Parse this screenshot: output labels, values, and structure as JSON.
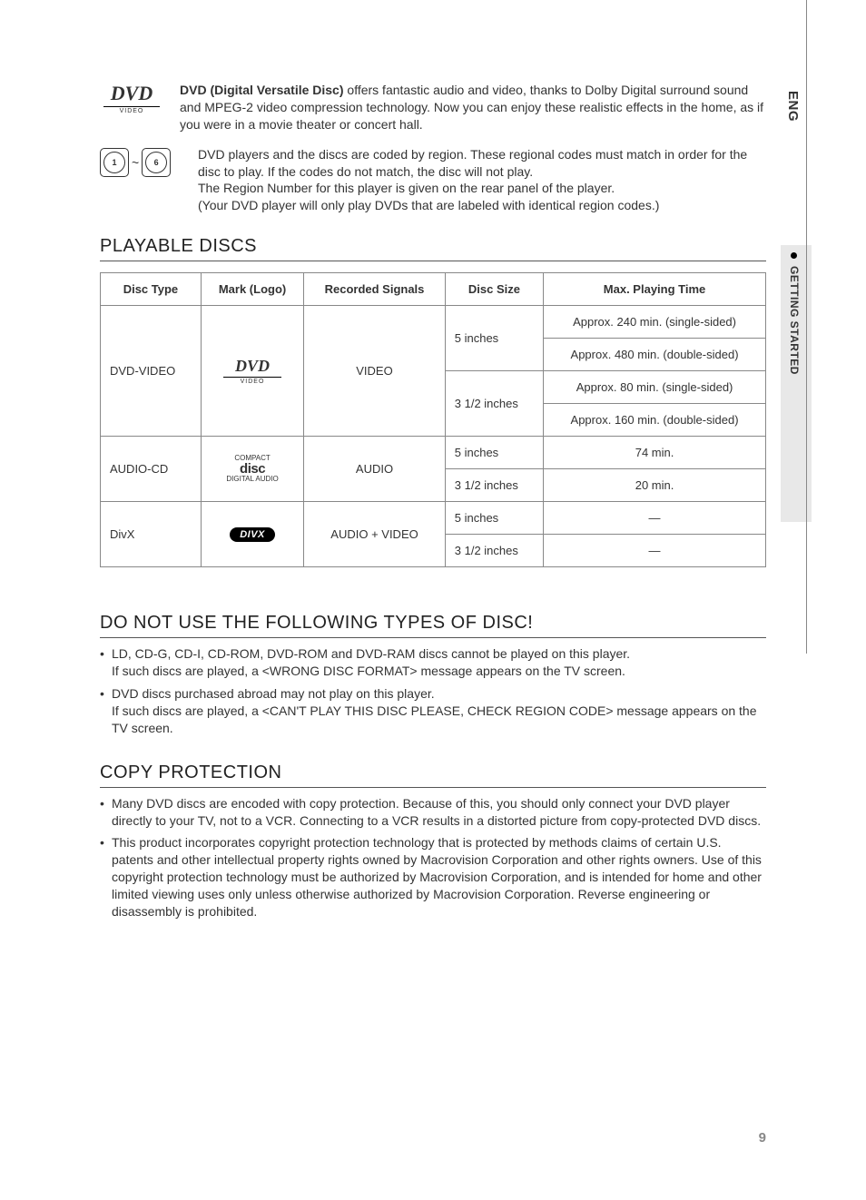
{
  "side": {
    "lang": "ENG",
    "section": "GETTING STARTED"
  },
  "intro": {
    "bold": "DVD (Digital Versatile Disc)",
    "p1_rest": " offers fantastic audio and video, thanks to Dolby Digital surround sound and MPEG-2 video compression technology. Now you can enjoy these realistic effects in the home, as if you were in a movie theater or concert hall.",
    "region_num1": "1",
    "region_tilde": "~",
    "region_num2": "6",
    "p2": "DVD players and the discs are coded by region. These regional codes must match in order for the disc to play. If the codes do not match, the disc will not play.",
    "p2b": "The Region Number for this player is given on the rear panel of the player.",
    "p2c": "(Your DVD player will only play DVDs that are labeled with identical region codes.)",
    "dvd_logo_main": "DVD",
    "dvd_logo_sub": "VIDEO"
  },
  "playable": {
    "heading": "PLAYABLE DISCS",
    "th1": "Disc Type",
    "th2": "Mark (Logo)",
    "th3": "Recorded Signals",
    "th4": "Disc Size",
    "th5": "Max. Playing Time",
    "r1_type": "DVD-VIDEO",
    "r1_signals": "VIDEO",
    "r1_size1": "5 inches",
    "r1_time1": "Approx. 240 min. (single-sided)",
    "r1_time2": "Approx. 480 min. (double-sided)",
    "r1_size2": "3 1/2 inches",
    "r1_time3": "Approx. 80 min. (single-sided)",
    "r1_time4": "Approx. 160 min. (double-sided)",
    "r2_type": "AUDIO-CD",
    "r2_signals": "AUDIO",
    "r2_size1": "5 inches",
    "r2_time1": "74 min.",
    "r2_size2": "3 1/2 inches",
    "r2_time2": "20 min.",
    "r3_type": "DivX",
    "r3_signals": "AUDIO + VIDEO",
    "r3_size1": "5 inches",
    "r3_time1": "—",
    "r3_size2": "3 1/2 inches",
    "r3_time2": "—",
    "divx_mark": "DIVX",
    "cd_logo_top": "COMPACT",
    "cd_logo_mid": "disc",
    "cd_logo_bot": "DIGITAL AUDIO"
  },
  "donotuse": {
    "heading": "DO NOT USE THE FOLLOWING TYPES OF DISC!",
    "b1a": "LD, CD-G, CD-I, CD-ROM, DVD-ROM and DVD-RAM discs cannot be played on this player.",
    "b1b": "If such discs are played, a <WRONG DISC FORMAT> message appears on the TV screen.",
    "b2a": "DVD discs purchased abroad may not play on this player.",
    "b2b": "If such discs are played, a <CAN'T PLAY THIS DISC PLEASE, CHECK REGION CODE> message appears on the TV screen."
  },
  "copy": {
    "heading": "COPY PROTECTION",
    "b1": "Many DVD discs are encoded with copy protection. Because of this, you should only connect your DVD player directly to your TV, not to a VCR. Connecting to a VCR results in a distorted picture from copy-protected DVD discs.",
    "b2": "This product incorporates copyright protection technology that is protected by methods claims of certain U.S. patents and other intellectual property rights owned by Macrovision Corporation and other rights owners. Use of this copyright protection technology must be authorized by Macrovision Corporation, and is intended for home and other limited viewing uses only unless otherwise authorized by Macrovision Corporation. Reverse engineering or disassembly is prohibited."
  },
  "page": "9"
}
